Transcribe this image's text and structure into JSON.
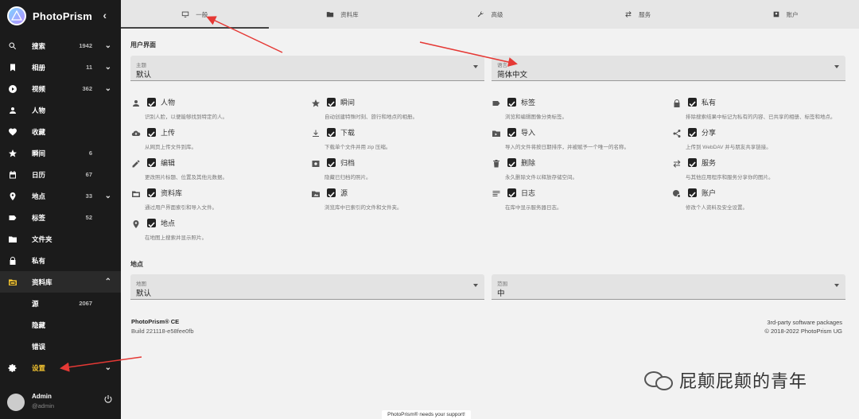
{
  "app": {
    "name": "PhotoPrism"
  },
  "sidebar": {
    "items": [
      {
        "label": "搜索",
        "count": "1942",
        "chevron": true,
        "icon": "search-icon"
      },
      {
        "label": "相册",
        "count": "11",
        "chevron": true,
        "icon": "bookmark-icon"
      },
      {
        "label": "视频",
        "count": "362",
        "chevron": true,
        "icon": "play-icon"
      },
      {
        "label": "人物",
        "count": "",
        "chevron": false,
        "icon": "person-icon"
      },
      {
        "label": "收藏",
        "count": "",
        "chevron": false,
        "icon": "heart-icon"
      },
      {
        "label": "瞬间",
        "count": "6",
        "chevron": false,
        "icon": "star-icon"
      },
      {
        "label": "日历",
        "count": "67",
        "chevron": false,
        "icon": "calendar-icon"
      },
      {
        "label": "地点",
        "count": "33",
        "chevron": true,
        "icon": "place-icon"
      },
      {
        "label": "标签",
        "count": "52",
        "chevron": false,
        "icon": "label-icon"
      },
      {
        "label": "文件夹",
        "count": "",
        "chevron": false,
        "icon": "folder-icon"
      },
      {
        "label": "私有",
        "count": "",
        "chevron": false,
        "icon": "lock-icon"
      },
      {
        "label": "资料库",
        "count": "",
        "chevron": true,
        "icon": "library-icon"
      },
      {
        "label": "源",
        "count": "2067",
        "chevron": false,
        "icon": ""
      },
      {
        "label": "隐藏",
        "count": "",
        "chevron": false,
        "icon": ""
      },
      {
        "label": "错误",
        "count": "",
        "chevron": false,
        "icon": ""
      },
      {
        "label": "设置",
        "count": "",
        "chevron": true,
        "icon": "gear-icon"
      }
    ],
    "user": {
      "name": "Admin",
      "handle": "@admin"
    }
  },
  "tabs": [
    {
      "label": "一般",
      "icon": "monitor-icon"
    },
    {
      "label": "资料库",
      "icon": "library-icon"
    },
    {
      "label": "高级",
      "icon": "wrench-icon"
    },
    {
      "label": "服务",
      "icon": "swap-icon"
    },
    {
      "label": "账户",
      "icon": "account-icon"
    }
  ],
  "ui_section": {
    "title": "用户界面",
    "theme": {
      "label": "主题",
      "value": "默认"
    },
    "language": {
      "label": "语言",
      "value": "简体中文"
    }
  },
  "features": [
    {
      "name": "人物",
      "desc": "识别人脸，以便能够找到特定的人。",
      "icon": "person-icon"
    },
    {
      "name": "瞬间",
      "desc": "自动创建特殊时刻、旅行和地点的相册。",
      "icon": "star-icon"
    },
    {
      "name": "标签",
      "desc": "浏览和编辑图像分类标签。",
      "icon": "label-icon"
    },
    {
      "name": "私有",
      "desc": "排除搜索结果中标记为私有的内容、已共享的相册、标签和地点。",
      "icon": "lock-icon"
    },
    {
      "name": "上传",
      "desc": "从网页上传文件到库。",
      "icon": "cloud-upload-icon"
    },
    {
      "name": "下载",
      "desc": "下载单个文件并用 zip 压缩。",
      "icon": "download-icon"
    },
    {
      "name": "导入",
      "desc": "导入的文件将按日期排序，并被赋予一个唯一的名称。",
      "icon": "folder-import-icon"
    },
    {
      "name": "分享",
      "desc": "上传到 WebDAV 并与朋友共享链接。",
      "icon": "share-icon"
    },
    {
      "name": "编辑",
      "desc": "更改照片标题、位置及其他元数据。",
      "icon": "pencil-icon"
    },
    {
      "name": "归档",
      "desc": "隐藏已归档的照片。",
      "icon": "archive-icon"
    },
    {
      "name": "删除",
      "desc": "永久删除文件以释放存储空间。",
      "icon": "trash-icon"
    },
    {
      "name": "服务",
      "desc": "与其他应用程序和服务分享你的图片。",
      "icon": "swap-icon"
    },
    {
      "name": "资料库",
      "desc": "通过用户界面索引和导入文件。",
      "icon": "library-icon"
    },
    {
      "name": "源",
      "desc": "浏览库中已索引的文件和文件夹。",
      "icon": "folder-image-icon"
    },
    {
      "name": "日志",
      "desc": "在库中显示服务器日志。",
      "icon": "log-icon"
    },
    {
      "name": "账户",
      "desc": "修改个人资料及安全设置。",
      "icon": "account-gear-icon"
    },
    {
      "name": "地点",
      "desc": "在地图上搜索并显示照片。",
      "icon": "place-icon"
    }
  ],
  "places_section": {
    "title": "地点",
    "map": {
      "label": "地图",
      "value": "默认"
    },
    "size": {
      "label": "范围",
      "value": "中"
    }
  },
  "footer": {
    "product": "PhotoPrism® CE",
    "build": "Build 221118-e58fee0fb",
    "third_party": "3rd-party software packages",
    "copyright": "© 2018-2022 PhotoPrism UG"
  },
  "support_banner": "PhotoPrism® needs your support!",
  "watermark": "屁颠屁颠的青年",
  "colors": {
    "sidebar_bg": "#1b1b1b",
    "settings_active": "#f4c430",
    "annotation_arrow": "#e53935"
  }
}
